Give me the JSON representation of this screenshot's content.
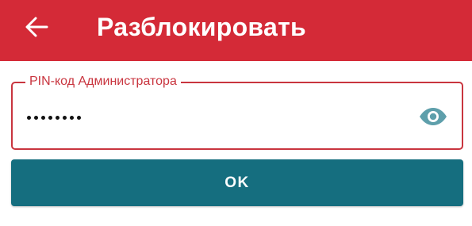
{
  "app_bar": {
    "title": "Разблокировать",
    "back_icon": "arrow-left-icon",
    "background_color": "#d42a37"
  },
  "pin_field": {
    "label": "PIN-код Администратора",
    "masked_value": "••••••••",
    "length": 8,
    "visibility_icon": "eye-icon",
    "accent_color": "#c9353f"
  },
  "ok_button": {
    "label": "OK",
    "background_color": "#156e7f"
  }
}
